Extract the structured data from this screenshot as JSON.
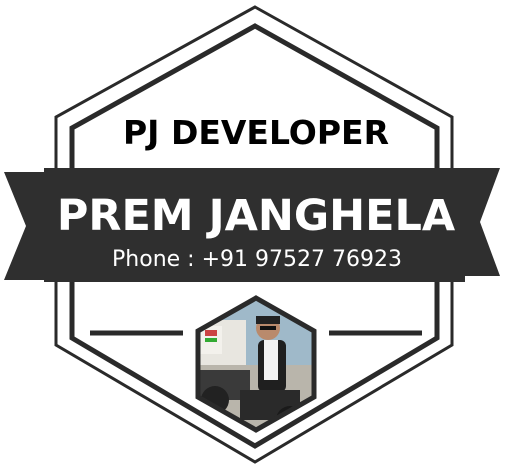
{
  "badge": {
    "company": "PJ DEVELOPER",
    "name": "PREM JANGHELA",
    "phone": "Phone : +91 97527 76923"
  },
  "colors": {
    "frame": "#2a2a2a",
    "ribbon": "#2f2f2f",
    "ribbon_fold": "#1a1a1a",
    "ribbon_text": "#ffffff",
    "title_text": "#000000",
    "photo_sky": "#9fb9c9",
    "photo_building": "#e8e6e0",
    "photo_ground": "#b9b5ab"
  },
  "photo": {
    "description_icon": "person-on-motorcycle-photo"
  }
}
